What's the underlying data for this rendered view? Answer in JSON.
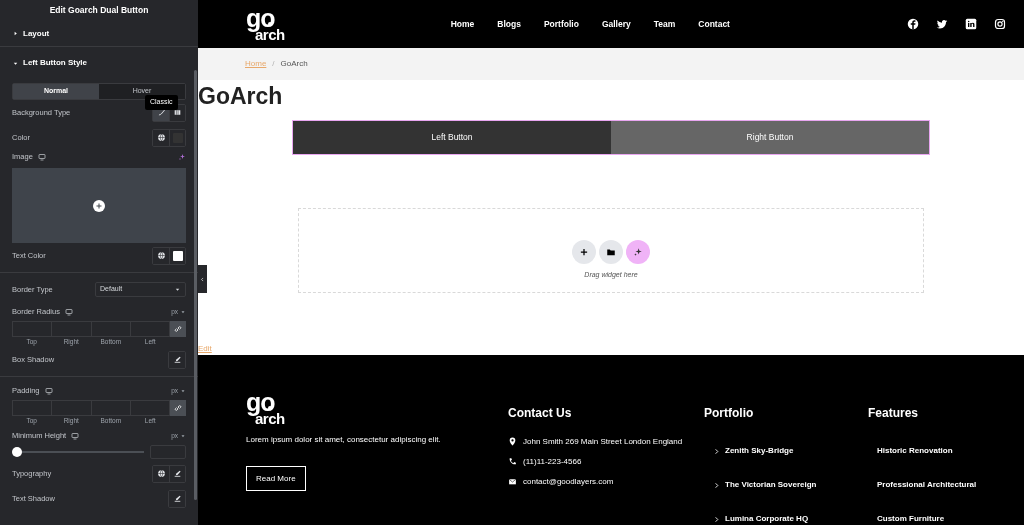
{
  "panel": {
    "title": "Edit Goarch Dual Button",
    "sections": [
      {
        "label": "Layout",
        "expanded": false
      },
      {
        "label": "Left Button Style",
        "expanded": true
      }
    ],
    "tabs": [
      {
        "label": "Normal",
        "selected": true
      },
      {
        "label": "Hover",
        "selected": false
      }
    ],
    "tooltip": "Classic",
    "controls": [
      {
        "kind": "icon-buttons",
        "label": "Background Type",
        "buttons": [
          {
            "kind": "brush",
            "selected": true
          },
          {
            "kind": "gradient",
            "selected": false
          }
        ]
      },
      {
        "kind": "icon-buttons",
        "label": "Color",
        "buttons": [
          {
            "kind": "globe",
            "selected": false
          },
          {
            "kind": "swatch",
            "selected": false,
            "color": "#333333"
          }
        ]
      },
      {
        "kind": "image",
        "label": "Image",
        "responsive": true
      },
      {
        "kind": "icon-buttons",
        "label": "Text Color",
        "buttons": [
          {
            "kind": "globe",
            "selected": false
          },
          {
            "kind": "swatch",
            "selected": false,
            "color": "#ffffff"
          }
        ]
      },
      {
        "kind": "divider"
      },
      {
        "kind": "select",
        "label": "Border Type",
        "value": "Default"
      },
      {
        "kind": "dimensions",
        "label": "Border Radius",
        "responsive": true,
        "unit": "px",
        "sides": [
          "Top",
          "Right",
          "Bottom",
          "Left"
        ]
      },
      {
        "kind": "icon-buttons",
        "label": "Box Shadow",
        "buttons": [
          {
            "kind": "edit",
            "selected": false
          }
        ]
      },
      {
        "kind": "divider"
      },
      {
        "kind": "dimensions",
        "label": "Padding",
        "responsive": true,
        "unit": "px",
        "sides": [
          "Top",
          "Right",
          "Bottom",
          "Left"
        ]
      },
      {
        "kind": "slider",
        "label": "Minimum Height",
        "responsive": true,
        "unit": "px",
        "level": 0
      },
      {
        "kind": "icon-buttons",
        "label": "Typography",
        "buttons": [
          {
            "kind": "globe",
            "selected": false
          },
          {
            "kind": "edit",
            "selected": false
          }
        ]
      },
      {
        "kind": "icon-buttons",
        "label": "Text Shadow",
        "buttons": [
          {
            "kind": "edit",
            "selected": false
          }
        ]
      }
    ]
  },
  "site": {
    "logo": {
      "top": "go",
      "bottom": "arch"
    },
    "nav": [
      "Home",
      "Blogs",
      "Portfolio",
      "Gallery",
      "Team",
      "Contact"
    ],
    "breadcrumb": {
      "link": "Home",
      "separator": "/",
      "current": "GoArch"
    },
    "page_title": "GoArch",
    "dual_button": {
      "left": "Left Button",
      "right": "Right Button"
    },
    "dropzone": {
      "hint": "Drag widget here"
    },
    "edit_link": "Edit",
    "footer": {
      "logo": {
        "top": "go",
        "bottom": "arch"
      },
      "about": "Lorem ipsum dolor sit amet, consectetur adipiscing elit.",
      "button": "Read More",
      "contact": {
        "heading": "Contact Us",
        "items": [
          {
            "kind": "address",
            "text": "John Smith 269 Main Street London England"
          },
          {
            "kind": "phone",
            "text": "(11)11-223-4566"
          },
          {
            "kind": "email",
            "text": "contact@goodlayers.com"
          }
        ]
      },
      "portfolio": {
        "heading": "Portfolio",
        "items": [
          "Zenith Sky-Bridge",
          "The Victorian Sovereign",
          "Lumina Corporate HQ"
        ]
      },
      "features": {
        "heading": "Features",
        "items": [
          "Historic Renovation",
          "Professional Architectural",
          "Custom Furniture"
        ]
      }
    }
  }
}
